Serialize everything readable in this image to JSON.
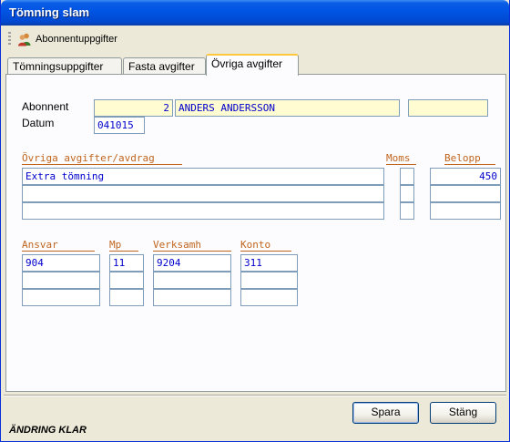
{
  "window": {
    "title": "Tömning slam"
  },
  "toolbar": {
    "items": [
      {
        "label": "Abonnentuppgifter",
        "icon": "subscriber-icon"
      }
    ]
  },
  "tabs": [
    {
      "label": "Tömningsuppgifter",
      "active": false
    },
    {
      "label": "Fasta avgifter",
      "active": false
    },
    {
      "label": "Övriga avgifter",
      "active": true
    }
  ],
  "form": {
    "abonnent_label": "Abonnent",
    "abonnent_number": "2",
    "abonnent_name": "ANDERS ANDERSSON",
    "abonnent_extra": "",
    "datum_label": "Datum",
    "datum_value": "041015"
  },
  "fees": {
    "header_desc": "Övriga avgifter/avdrag",
    "header_moms": "Moms",
    "header_belopp": "Belopp",
    "rows": [
      {
        "desc": "Extra tömning",
        "moms": "",
        "belopp": "450"
      },
      {
        "desc": "",
        "moms": "",
        "belopp": ""
      },
      {
        "desc": "",
        "moms": "",
        "belopp": ""
      }
    ]
  },
  "accounting": {
    "header_ansvar": "Ansvar",
    "header_mp": "Mp",
    "header_verksamh": "Verksamh",
    "header_konto": "Konto",
    "rows": [
      {
        "ansvar": "904",
        "mp": "11",
        "verksamh": "9204",
        "konto": "311"
      },
      {
        "ansvar": "",
        "mp": "",
        "verksamh": "",
        "konto": ""
      },
      {
        "ansvar": "",
        "mp": "",
        "verksamh": "",
        "konto": ""
      }
    ]
  },
  "buttons": {
    "save": "Spara",
    "close": "Stäng"
  },
  "status": {
    "text": "ÄNDRING KLAR"
  },
  "colors": {
    "header": "#c0651e",
    "value_text": "#0000cc",
    "highlight_field": "#fffcd2",
    "titlebar": "#0054e3"
  }
}
